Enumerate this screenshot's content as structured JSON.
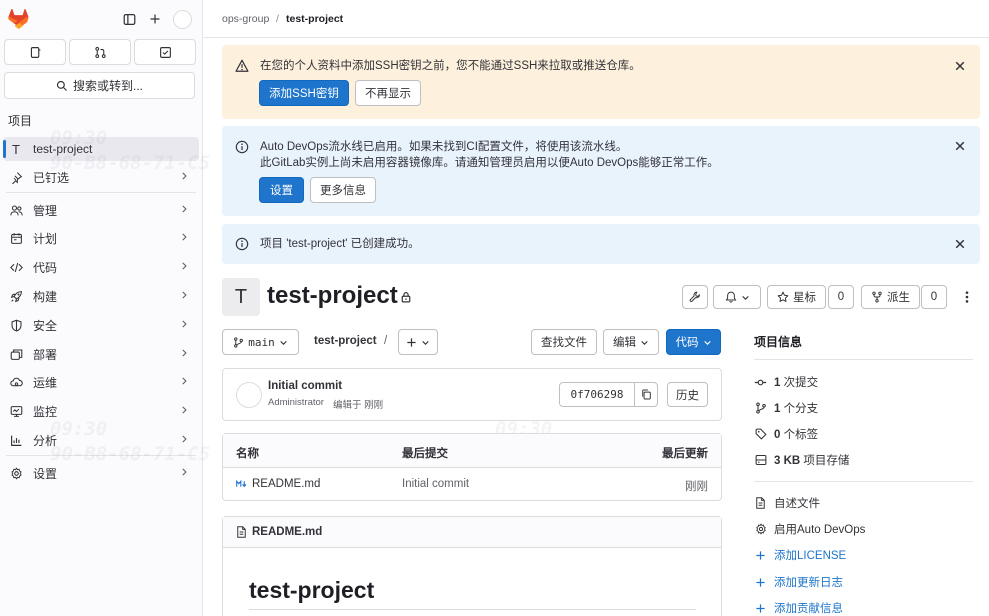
{
  "sidebar": {
    "search_label": "搜索或转到...",
    "section_title": "项目",
    "project_avatar": "T",
    "items": [
      {
        "label": "test-project"
      },
      {
        "label": "已钉选"
      },
      {
        "label": "管理"
      },
      {
        "label": "计划"
      },
      {
        "label": "代码"
      },
      {
        "label": "构建"
      },
      {
        "label": "安全"
      },
      {
        "label": "部署"
      },
      {
        "label": "运维"
      },
      {
        "label": "监控"
      },
      {
        "label": "分析"
      },
      {
        "label": "设置"
      }
    ]
  },
  "breadcrumb": {
    "group": "ops-group",
    "separator": "/",
    "project": "test-project"
  },
  "alerts": {
    "ssh": {
      "text": "在您的个人资料中添加SSH密钥之前，您不能通过SSH来拉取或推送仓库。",
      "primary_button": "添加SSH密钥",
      "secondary_button": "不再显示"
    },
    "devops": {
      "line1": "Auto DevOps流水线已启用。如果未找到CI配置文件，将使用该流水线。",
      "line2": "此GitLab实例上尚未启用容器镜像库。请通知管理员启用以便Auto DevOps能够正常工作。",
      "primary_button": "设置",
      "secondary_button": "更多信息"
    },
    "created": {
      "text": "项目 'test-project' 已创建成功。"
    }
  },
  "project": {
    "avatar": "T",
    "name": "test-project",
    "star_label": "星标",
    "star_count": "0",
    "fork_label": "派生",
    "fork_count": "0"
  },
  "repo_bar": {
    "branch": "main",
    "path": "test-project",
    "path_sep": "/",
    "find_file": "查找文件",
    "edit": "编辑",
    "code": "代码"
  },
  "commit": {
    "title": "Initial commit",
    "author": "Administrator",
    "meta": "编辑于 刚刚",
    "sha": "0f706298",
    "history": "历史"
  },
  "file_table": {
    "headers": [
      "名称",
      "最后提交",
      "最后更新"
    ],
    "rows": [
      {
        "name": "README.md",
        "commit": "Initial commit",
        "updated": "刚刚"
      }
    ]
  },
  "readme": {
    "filename": "README.md",
    "heading": "test-project"
  },
  "project_info": {
    "title": "项目信息",
    "stats": [
      {
        "value": "1",
        "label": "次提交"
      },
      {
        "value": "1",
        "label": "个分支"
      },
      {
        "value": "0",
        "label": "个标签"
      },
      {
        "value": "3 KB",
        "label": "项目存储"
      }
    ],
    "links": [
      {
        "label": "自述文件"
      },
      {
        "label": "启用Auto DevOps"
      },
      {
        "label": "添加LICENSE"
      },
      {
        "label": "添加更新日志"
      },
      {
        "label": "添加贡献信息"
      }
    ]
  },
  "watermark": {
    "time": "09:30",
    "mac": "90-B8-68-71-C5"
  },
  "colors": {
    "primary": "#1f75cb",
    "warning_bg": "#fdf1dd",
    "info_bg": "#e9f3fc",
    "brand": "#e24329"
  }
}
